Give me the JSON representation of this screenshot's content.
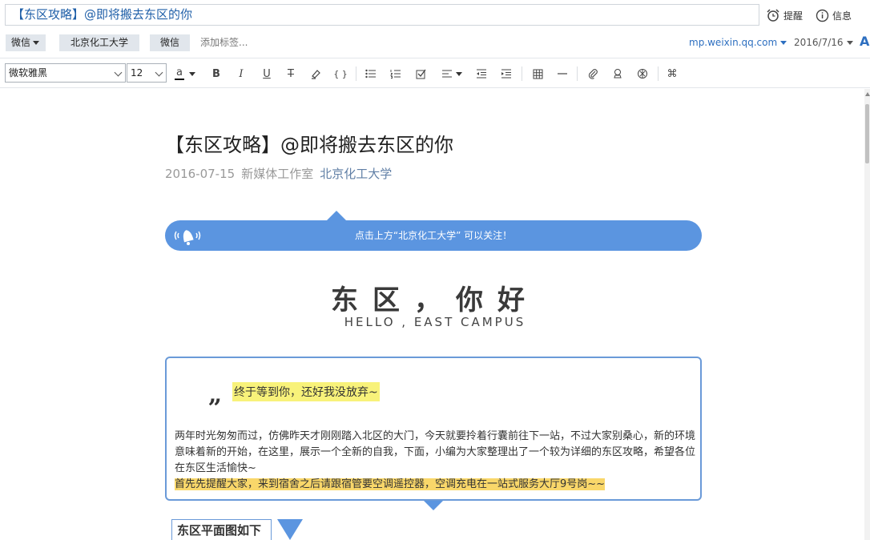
{
  "header": {
    "title_value": "【东区攻略】@即将搬去东区的你",
    "remind_label": "提醒",
    "info_label": "信息"
  },
  "tags": {
    "folder_label": "微信",
    "items": [
      "北京化工大学",
      "微信"
    ],
    "add_placeholder": "添加标签...",
    "source": "mp.weixin.qq.com",
    "date": "2016/7/16",
    "font_toggle": "A"
  },
  "toolbar": {
    "font_family": "微软雅黑",
    "font_size": "12",
    "color_glyph": "a",
    "bold": "B",
    "italic": "I",
    "underline": "U",
    "strike": "T",
    "code": "{ }"
  },
  "article": {
    "title": "【东区攻略】@即将搬去东区的你",
    "date": "2016-07-15",
    "author": "新媒体工作室",
    "account": "北京化工大学",
    "banner_text": "点击上方“北京化工大学” 可以关注！",
    "hero_cn": "东区，你好",
    "hero_en": "HELLO , EAST CAMPUS",
    "quote_mark": "„",
    "quote_highlight": "终于等到你，还好我没放弃~",
    "paragraph": "两年时光匆匆而过，仿佛昨天才刚刚踏入北区的大门，今天就要拎着行囊前往下一站，不过大家别桑心，新的环境意味着新的开始，在这里，展示一个全新的自我，下面，小编为大家整理出了一个较为详细的东区攻略，希望各位在东区生活愉快~",
    "paragraph_highlight": "首先先提醒大家，来到宿舍之后请跟宿管要空调遥控器，空调充电在一站式服务大厅9号岗~~",
    "section_heading": "东区平面图如下"
  },
  "colors": {
    "accent_blue": "#5b95e0",
    "highlight_yellow": "#f8f27a",
    "highlight_orange": "#f9d76a",
    "link_blue": "#2d6fc0"
  }
}
